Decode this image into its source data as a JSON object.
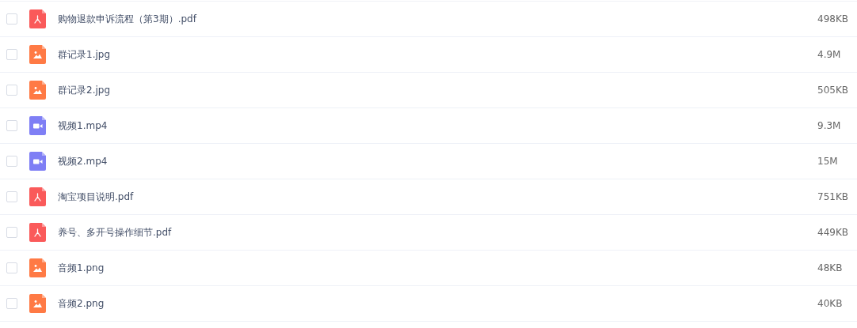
{
  "files": [
    {
      "name": "购物退款申诉流程（第3期）.pdf",
      "kind": "pdf",
      "size": "498KB",
      "checked": false
    },
    {
      "name": "群记录1.jpg",
      "kind": "image",
      "size": "4.9M",
      "checked": false
    },
    {
      "name": "群记录2.jpg",
      "kind": "image",
      "size": "505KB",
      "checked": false
    },
    {
      "name": "视频1.mp4",
      "kind": "video",
      "size": "9.3M",
      "checked": false
    },
    {
      "name": "视频2.mp4",
      "kind": "video",
      "size": "15M",
      "checked": false
    },
    {
      "name": "淘宝项目说明.pdf",
      "kind": "pdf",
      "size": "751KB",
      "checked": false
    },
    {
      "name": "养号、多开号操作细节.pdf",
      "kind": "pdf",
      "size": "449KB",
      "checked": false
    },
    {
      "name": "音频1.png",
      "kind": "image",
      "size": "48KB",
      "checked": false
    },
    {
      "name": "音频2.png",
      "kind": "image",
      "size": "40KB",
      "checked": false
    }
  ]
}
